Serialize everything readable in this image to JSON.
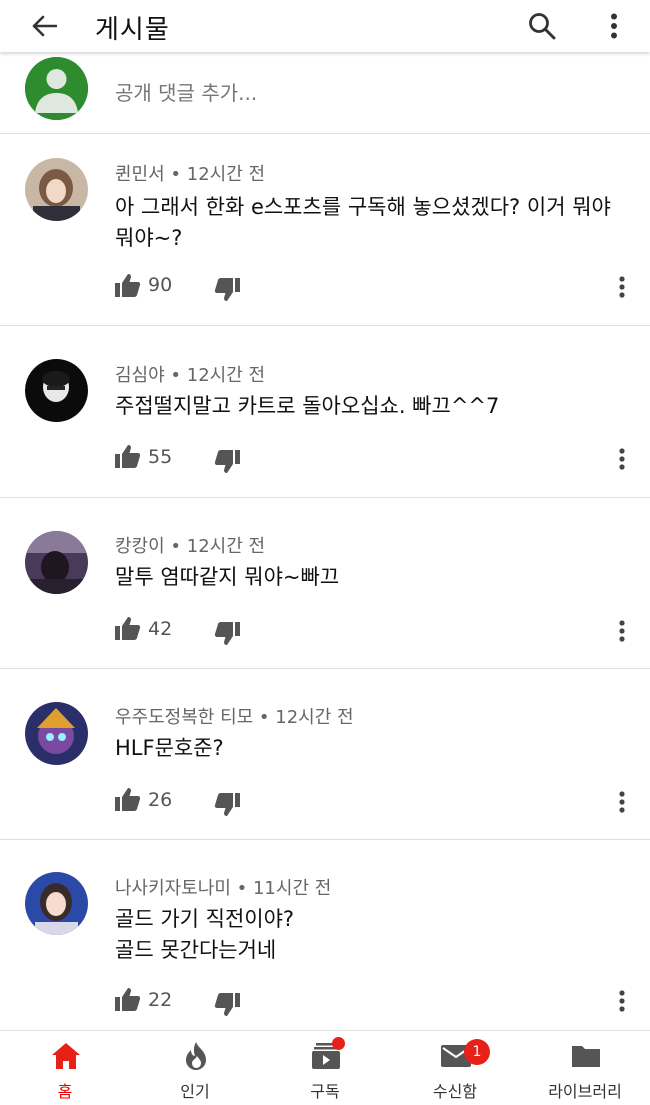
{
  "header": {
    "title": "게시물"
  },
  "composer": {
    "placeholder": "공개 댓글 추가..."
  },
  "comments": [
    {
      "author": "퀸민서",
      "time": "12시간 전",
      "text": "아 그래서 한화 e스포츠를 구독해 놓으셨겠다? 이거 뭐야 뭐야~?",
      "likes": "90"
    },
    {
      "author": "김심야",
      "time": "12시간 전",
      "text": "주접떨지말고 카트로 돌아오십쇼. 빠끄^^7",
      "likes": "55"
    },
    {
      "author": "캉캉이",
      "time": "12시간 전",
      "text": "말투 염따같지 뭐야~빠끄",
      "likes": "42"
    },
    {
      "author": "우주도정복한 티모",
      "time": "12시간 전",
      "text": "HLF문호준?",
      "likes": "26"
    },
    {
      "author": "나사키자토나미",
      "time": "11시간 전",
      "text": "골드 가기 직전이야?\n골드 못간다는거네",
      "likes": "22"
    }
  ],
  "nav": {
    "home": "홈",
    "trending": "인기",
    "subscriptions": "구독",
    "inbox": "수신함",
    "inbox_badge": "1",
    "library": "라이브러리"
  },
  "colors": {
    "accent": "#e62117",
    "text": "#0f0f0f",
    "meta": "#666666"
  }
}
